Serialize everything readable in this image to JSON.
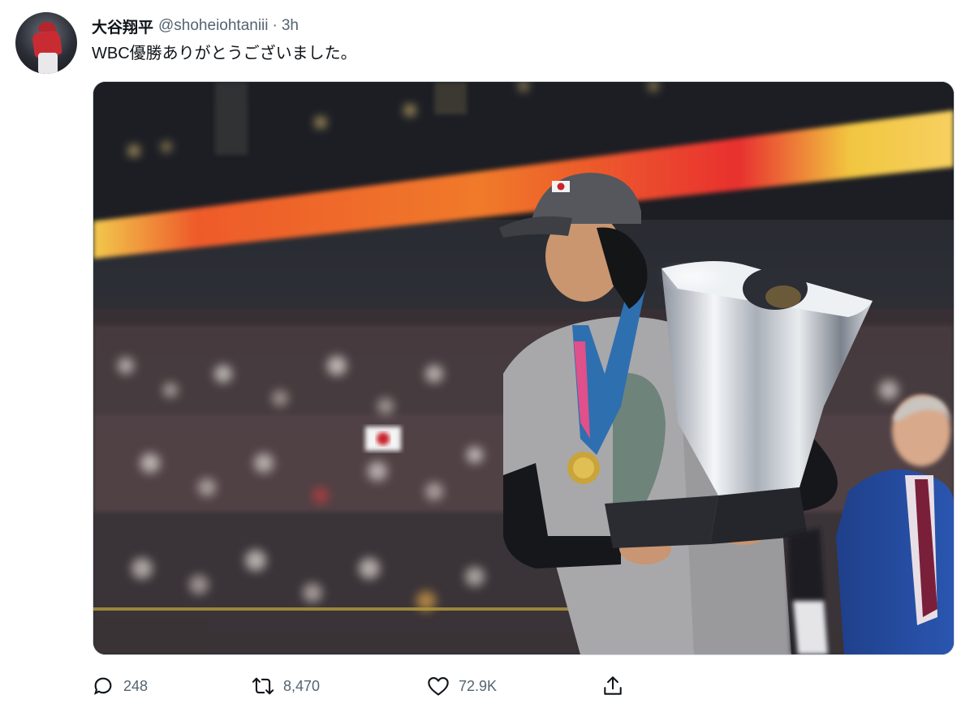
{
  "author": {
    "display_name": "大谷翔平",
    "handle": "@shoheiohtaniii",
    "separator": "·",
    "time": "3h",
    "avatar_icon": "avatar-photo"
  },
  "tweet": {
    "text": "WBC優勝ありがとうございました。"
  },
  "media": {
    "type": "photo",
    "description_icon": "photo-trophy-celebration"
  },
  "actions": {
    "reply": {
      "icon": "reply-bubble-icon",
      "count": "248"
    },
    "retweet": {
      "icon": "retweet-icon",
      "count": "8,470"
    },
    "like": {
      "icon": "heart-icon",
      "count": "72.9K"
    },
    "share": {
      "icon": "share-upload-icon"
    }
  },
  "colors": {
    "text_primary": "#0f1419",
    "text_secondary": "#536471",
    "border": "#cfd9de"
  }
}
